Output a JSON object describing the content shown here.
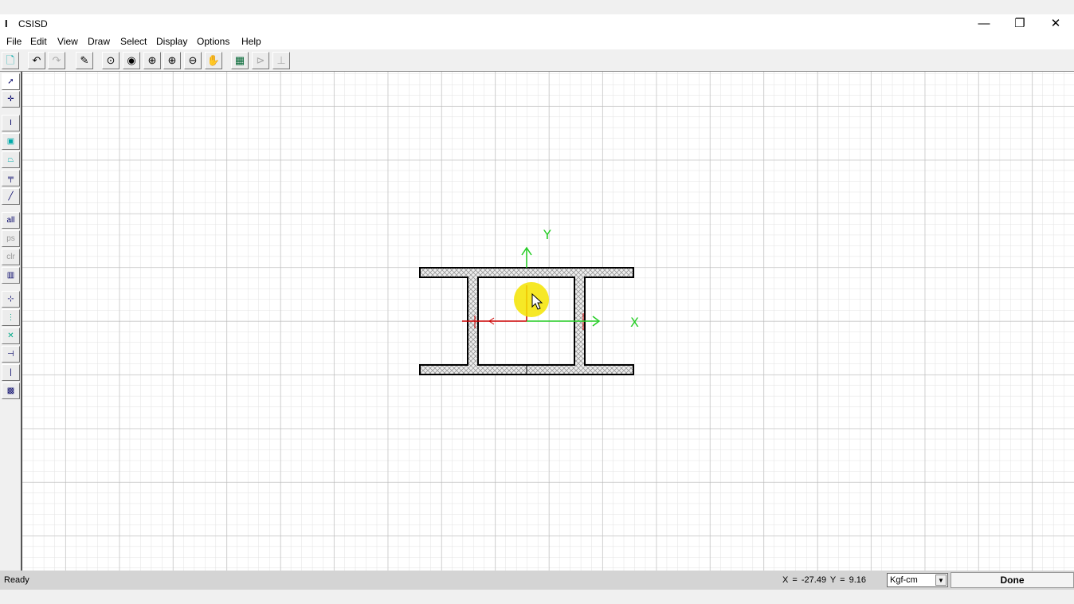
{
  "window": {
    "title": "CSISD",
    "icon": "app-icon",
    "minimize": "—",
    "restore": "❐",
    "close": "✕"
  },
  "menu": [
    "File",
    "Edit",
    "View",
    "Draw",
    "Select",
    "Display",
    "Options",
    "Help"
  ],
  "toolbar": {
    "new": "🗋",
    "undo": "↶",
    "redo": "↷",
    "pencil": "✎",
    "zoom_window": "⊙",
    "zoom_prev": "◉",
    "zoom_restore": "⊕",
    "zoom_in": "⊕",
    "zoom_out": "⊖",
    "pan": "✋",
    "table": "▦",
    "shape_a": "⊳",
    "shape_b": "⊥"
  },
  "left_toolbar": {
    "all": "all",
    "ps": "ps",
    "clr": "clr"
  },
  "drawing": {
    "axis_x": "X",
    "axis_y": "Y",
    "axis_color": "#22cc22",
    "section_color": "#000000",
    "hatch_color": "#999999",
    "ref_color": "#cc0000"
  },
  "status": {
    "ready": "Ready",
    "coords": "X = -27.49   Y = 9.16",
    "units": "Kgf-cm",
    "done": "Done"
  }
}
